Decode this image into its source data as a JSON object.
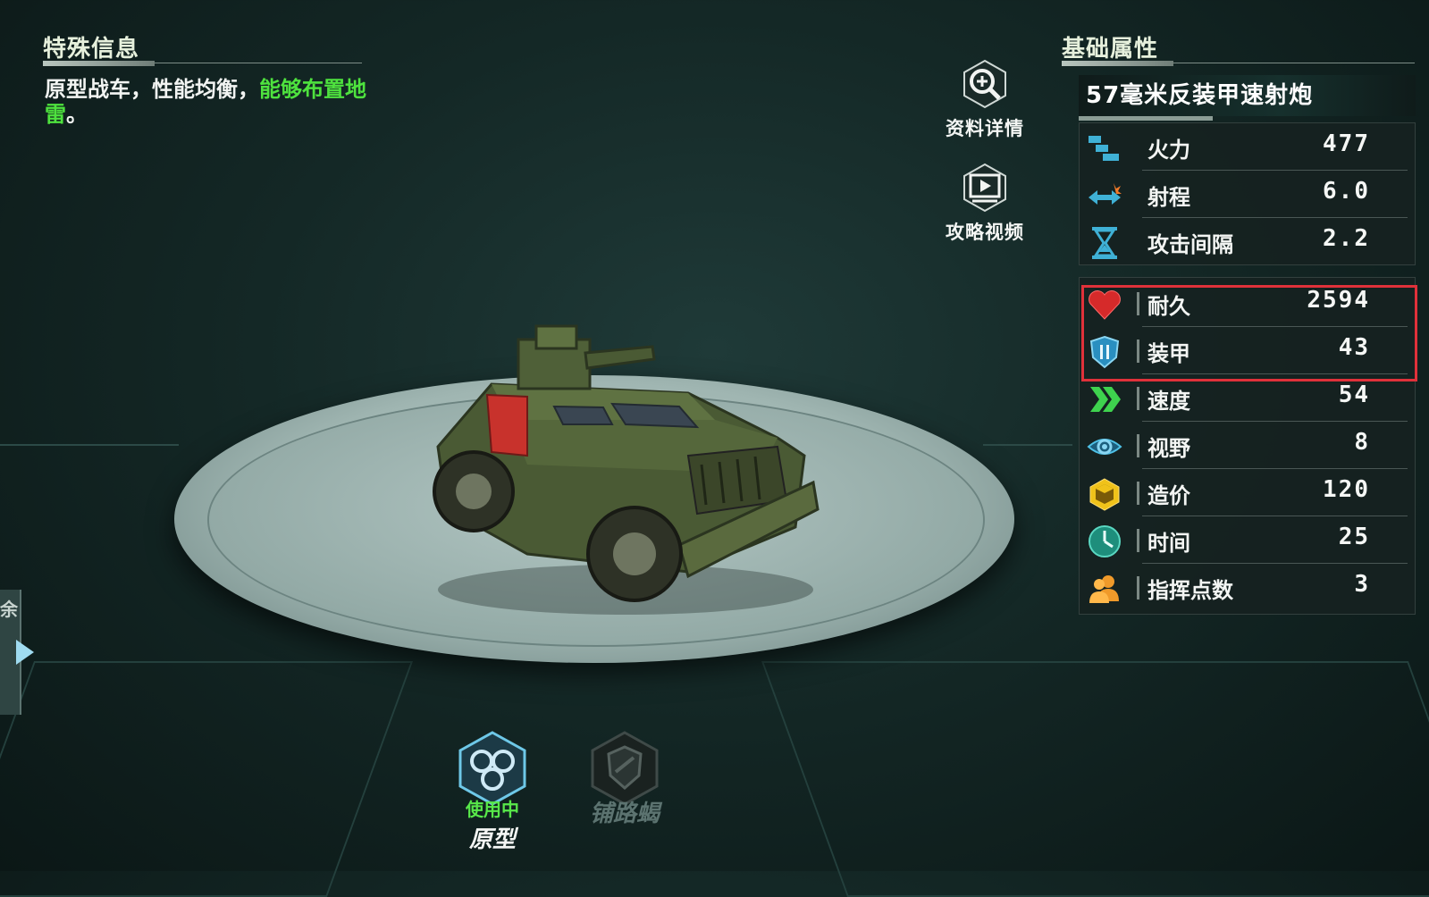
{
  "special_info": {
    "title": "特殊信息",
    "text_normal": "原型战车，性能均衡，",
    "text_highlight": "能够布置地雷",
    "text_end": "。"
  },
  "actions": {
    "details_label": "资料详情",
    "video_label": "攻略视频"
  },
  "basic_attributes": {
    "title": "基础属性",
    "weapon_name": "57毫米反装甲速射炮",
    "attack_stats": [
      {
        "label": "火力",
        "value": "477",
        "icon": "firepower-icon"
      },
      {
        "label": "射程",
        "value": "6.0",
        "icon": "range-icon"
      },
      {
        "label": "攻击间隔",
        "value": "2.2",
        "icon": "hourglass-icon"
      }
    ],
    "unit_stats": [
      {
        "label": "耐久",
        "value": "2594",
        "icon": "heart-icon"
      },
      {
        "label": "装甲",
        "value": "43",
        "icon": "armor-shield-icon"
      },
      {
        "label": "速度",
        "value": "54",
        "icon": "speed-chevron-icon"
      },
      {
        "label": "视野",
        "value": "8",
        "icon": "eye-icon"
      },
      {
        "label": "造价",
        "value": "120",
        "icon": "cost-cube-icon"
      },
      {
        "label": "时间",
        "value": "25",
        "icon": "clock-icon"
      },
      {
        "label": "指挥点数",
        "value": "3",
        "icon": "command-users-icon"
      }
    ]
  },
  "variants": [
    {
      "name": "原型",
      "status": "使用中",
      "active": true
    },
    {
      "name": "铺路蝎",
      "status": "",
      "active": false
    }
  ],
  "left_tab_char": "余",
  "colors": {
    "highlight_green": "#4ee23e",
    "selection_red": "#e0313a"
  }
}
